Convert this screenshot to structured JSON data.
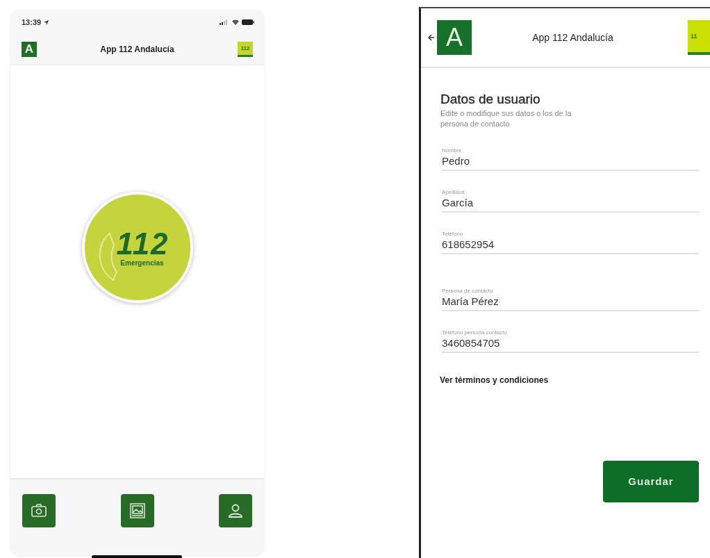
{
  "home": {
    "status_bar": {
      "time": "13:39"
    },
    "header": {
      "logo_letter": "A",
      "title": "App 112 Andalucía",
      "badge": "112"
    },
    "emergency_button": {
      "number": "112",
      "label": "Emergencias"
    },
    "toolbar": [
      {
        "kind": "camera"
      },
      {
        "kind": "gallery"
      },
      {
        "kind": "profile"
      }
    ]
  },
  "profile": {
    "header": {
      "logo_letter": "A",
      "title": "App 112 Andalucía",
      "badge": "11"
    },
    "heading": "Datos de usuario",
    "subtitle": "Edite o modifique sus datos o los de la persona de contacto",
    "fields": [
      {
        "label": "Nombre",
        "value": "Pedro"
      },
      {
        "label": "Apellidos",
        "value": "García"
      },
      {
        "label": "Teléfono",
        "value": "618652954"
      }
    ],
    "contact_fields": [
      {
        "label": "Persona de contacto",
        "value": "María Pérez"
      },
      {
        "label": "Teléfono persona contacto",
        "value": "3460854705"
      }
    ],
    "terms_link": "Ver términos y condiciones",
    "save_button": "Guardar"
  }
}
